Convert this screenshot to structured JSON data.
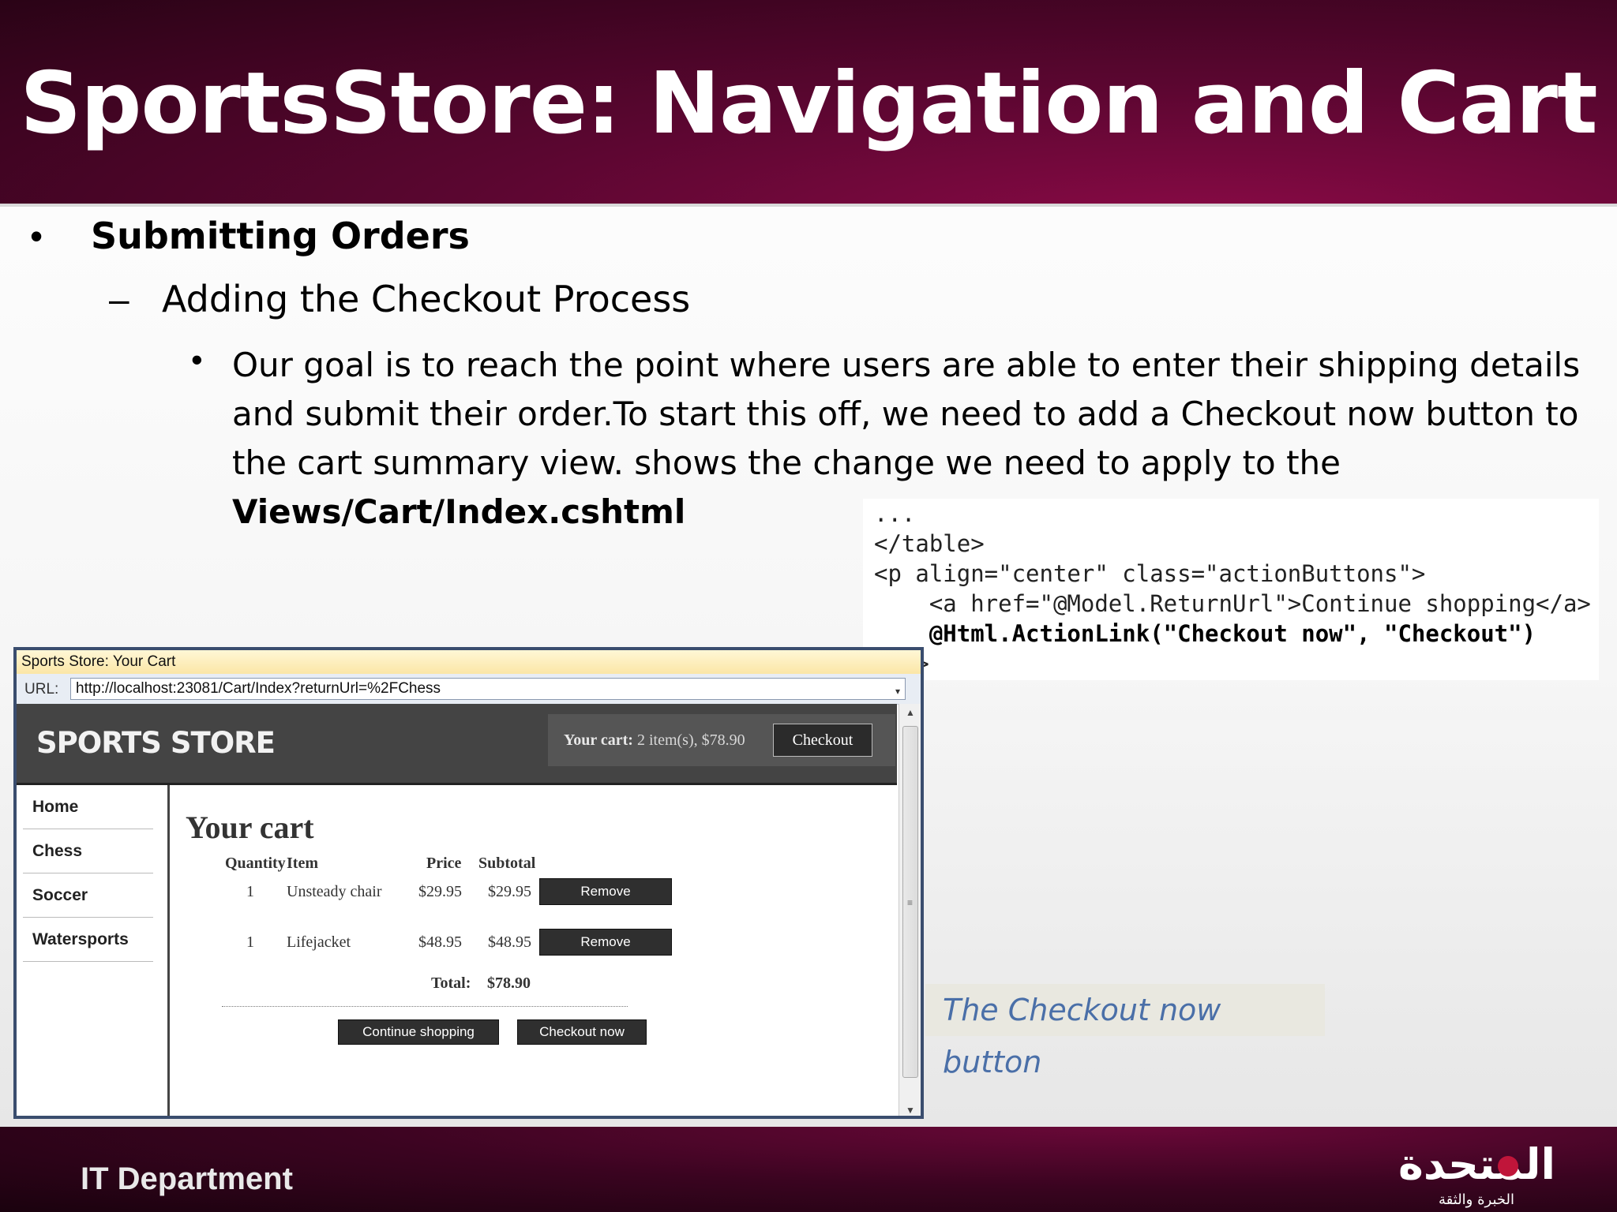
{
  "slide": {
    "title": "SportsStore: Navigation and Cart",
    "bullet1": "Submitting Orders",
    "bullet2": "Adding the Checkout Process",
    "bullet3_text": "Our goal is to reach the point where users are able to enter their shipping details and submit their order.To start this off, we need to add a Checkout now button to the cart summary view. shows the change we need to apply to the",
    "bullet3_bold": "Views/Cart/Index.cshtml",
    "caption": "The Checkout now button",
    "footer": "IT Department",
    "logo_text": "المتحدة",
    "logo_subtext": "الخبرة والثقة"
  },
  "code": {
    "lines": [
      "...",
      "</table>",
      "<p align=\"center\" class=\"actionButtons\">",
      "    <a href=\"@Model.ReturnUrl\">Continue shopping</a>",
      "    @Html.ActionLink(\"Checkout now\", \"Checkout\")",
      "</p>"
    ]
  },
  "browser": {
    "window_title": "Sports Store: Your Cart",
    "url_label": "URL:",
    "url": "http://localhost:23081/Cart/Index?returnUrl=%2FChess",
    "site_logo": "SPORTS STORE",
    "cart_summary_label": "Your cart:",
    "cart_summary_value": "2 item(s), $78.90",
    "checkout_label": "Checkout",
    "nav": [
      "Home",
      "Chess",
      "Soccer",
      "Watersports"
    ],
    "heading": "Your cart",
    "table": {
      "headers": [
        "Quantity",
        "Item",
        "Price",
        "Subtotal"
      ],
      "rows": [
        {
          "quantity": "1",
          "item": "Unsteady chair",
          "price": "$29.95",
          "subtotal": "$29.95",
          "action": "Remove"
        },
        {
          "quantity": "1",
          "item": "Lifejacket",
          "price": "$48.95",
          "subtotal": "$48.95",
          "action": "Remove"
        }
      ],
      "total_label": "Total:",
      "total_value": "$78.90"
    },
    "continue_shopping": "Continue shopping",
    "checkout_now": "Checkout now"
  },
  "colors": {
    "header_bg": "#5a0630",
    "caption_text": "#4a6fa8",
    "site_header_bg": "#444444"
  }
}
